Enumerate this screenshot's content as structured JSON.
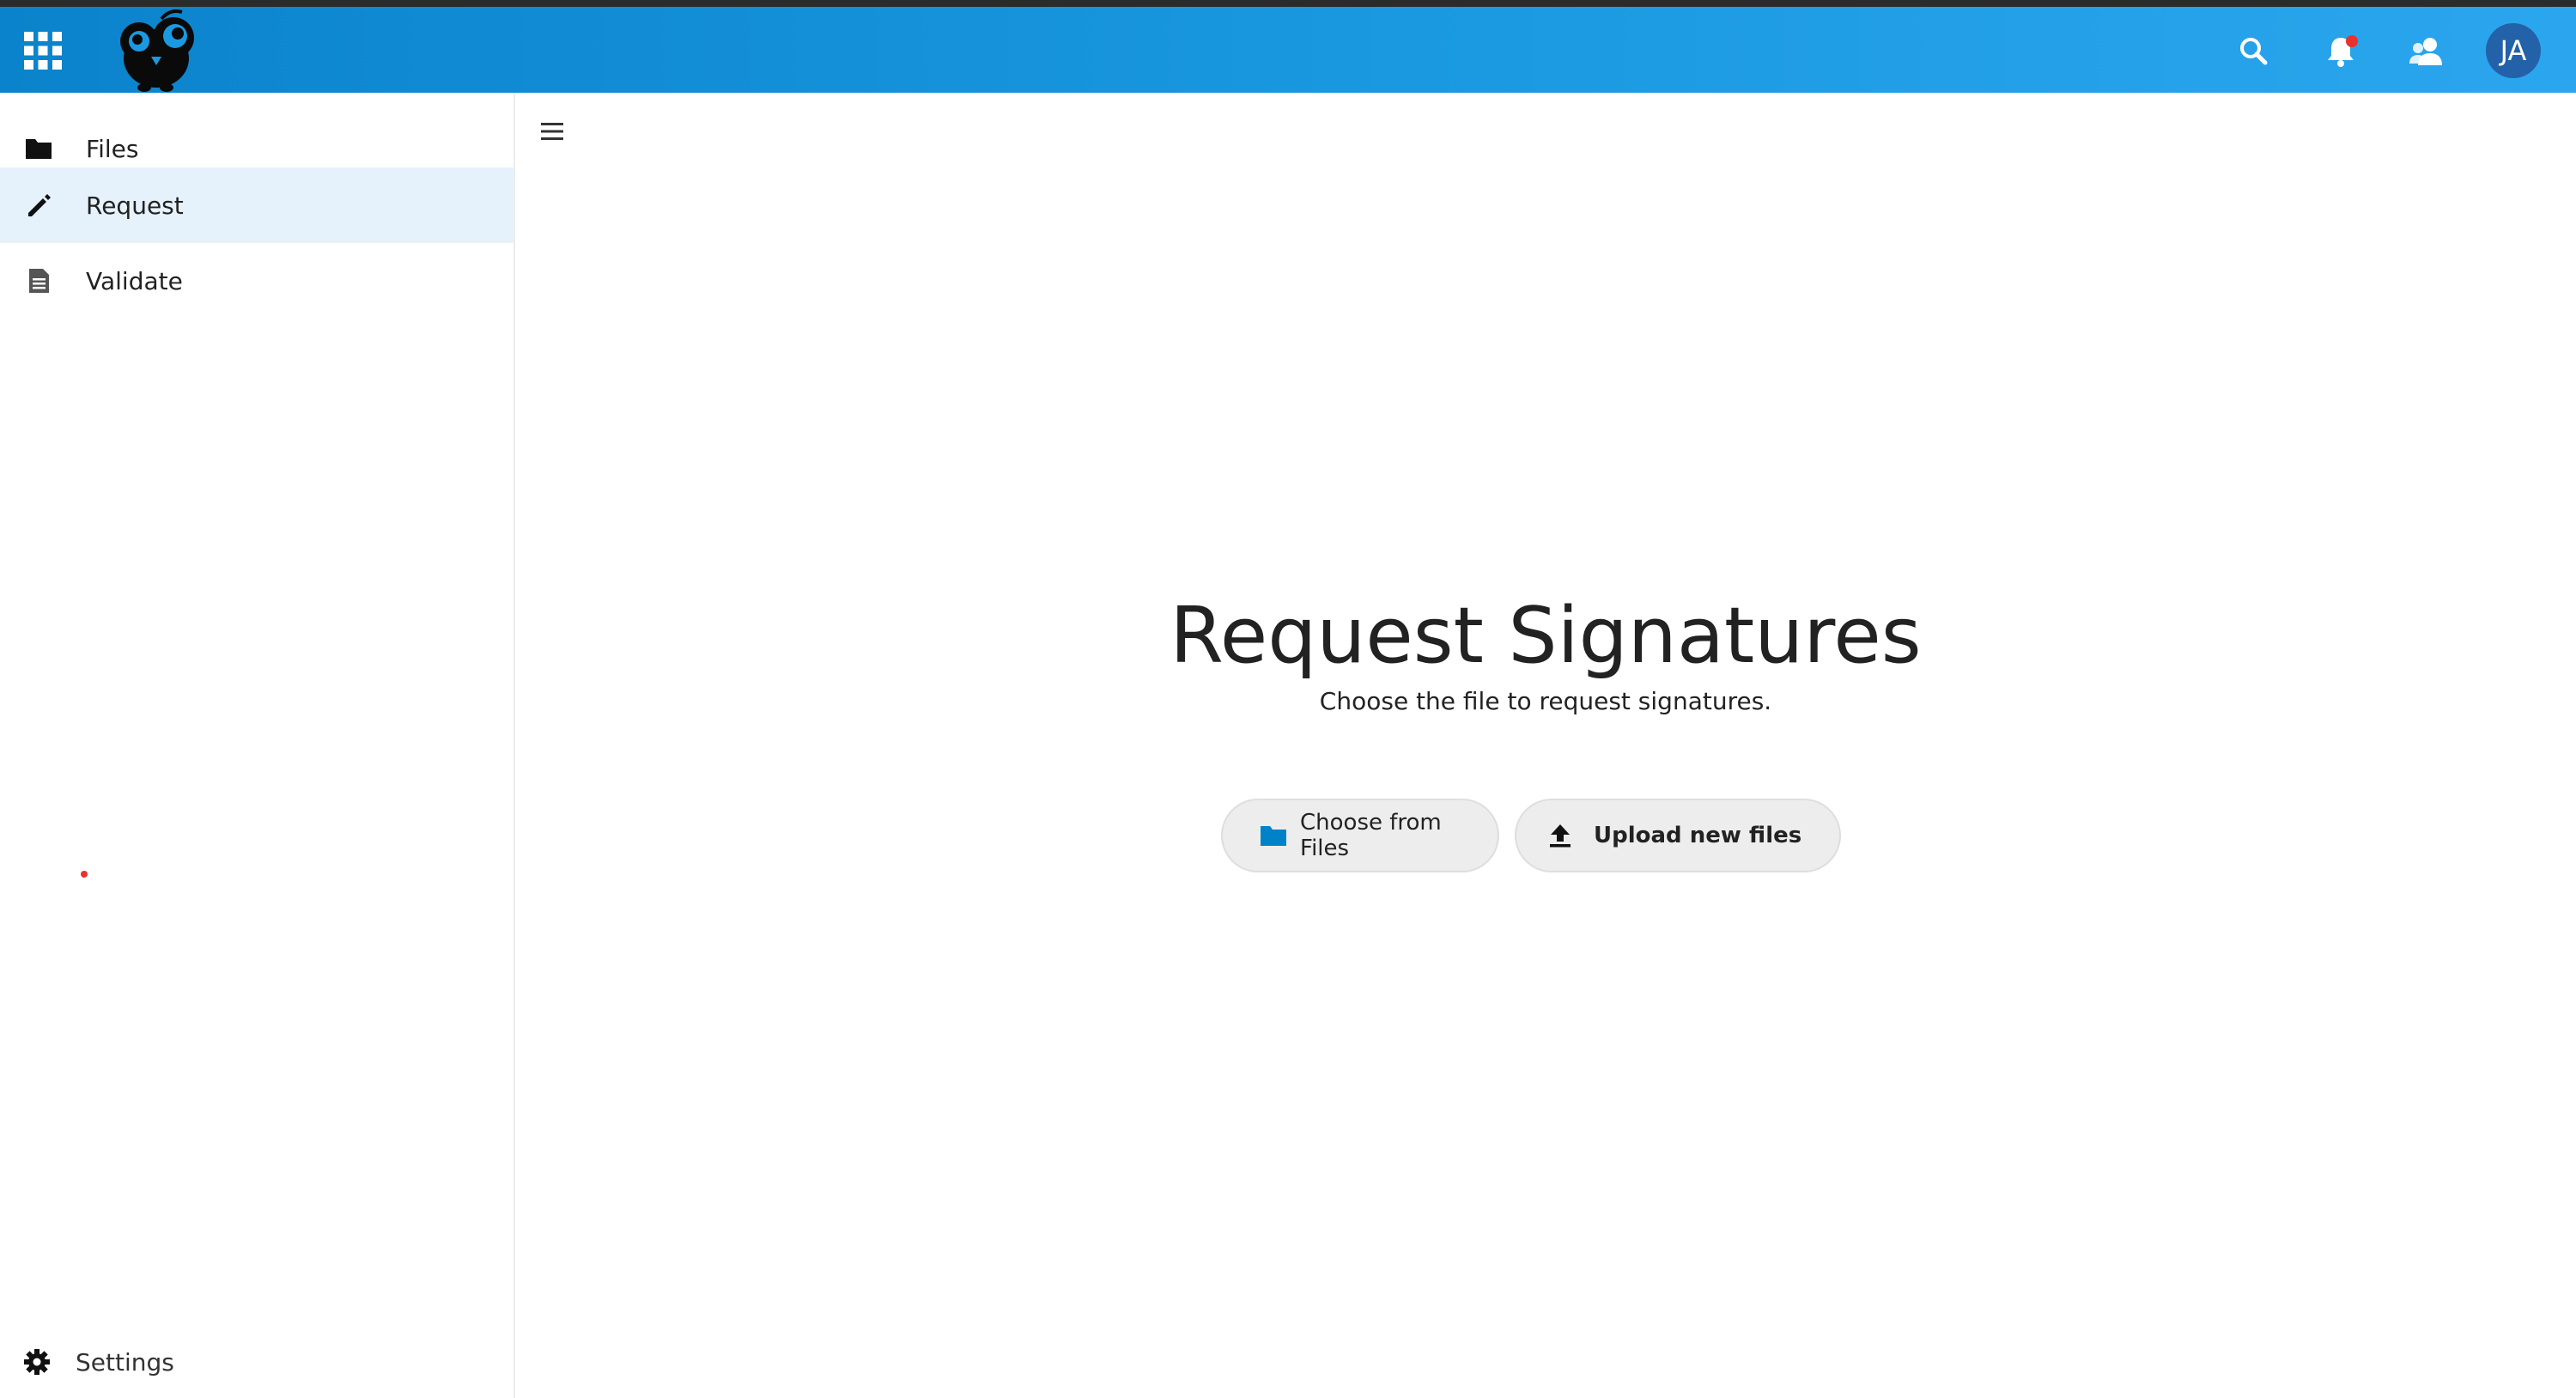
{
  "header": {
    "apps_icon": "apps-grid-icon",
    "logo_icon": "owl-logo-icon",
    "search_icon": "search-icon",
    "notifications_icon": "bell-icon",
    "contacts_icon": "contacts-icon",
    "avatar_initials": "JA",
    "colors": {
      "gradient_start": "#0b83cc",
      "gradient_end": "#2ba6ee",
      "avatar_bg": "#2361a8",
      "notification_dot": "#e9322d"
    }
  },
  "sidebar": {
    "items": [
      {
        "label": "Files",
        "icon": "folder-icon",
        "active": false
      },
      {
        "label": "Request",
        "icon": "pencil-icon",
        "active": true
      },
      {
        "label": "Validate",
        "icon": "document-icon",
        "active": false
      }
    ],
    "settings_label": "Settings",
    "settings_icon": "gear-icon",
    "colors": {
      "active_bg": "#e6f2fb"
    }
  },
  "main": {
    "toggle_icon": "hamburger-menu-icon",
    "title": "Request Signatures",
    "subtitle": "Choose the file to request signatures.",
    "buttons": {
      "choose_label": "Choose from Files",
      "choose_icon": "folder-icon",
      "upload_label": "Upload new files",
      "upload_icon": "upload-icon"
    },
    "colors": {
      "folder_accent": "#0082c9"
    }
  }
}
